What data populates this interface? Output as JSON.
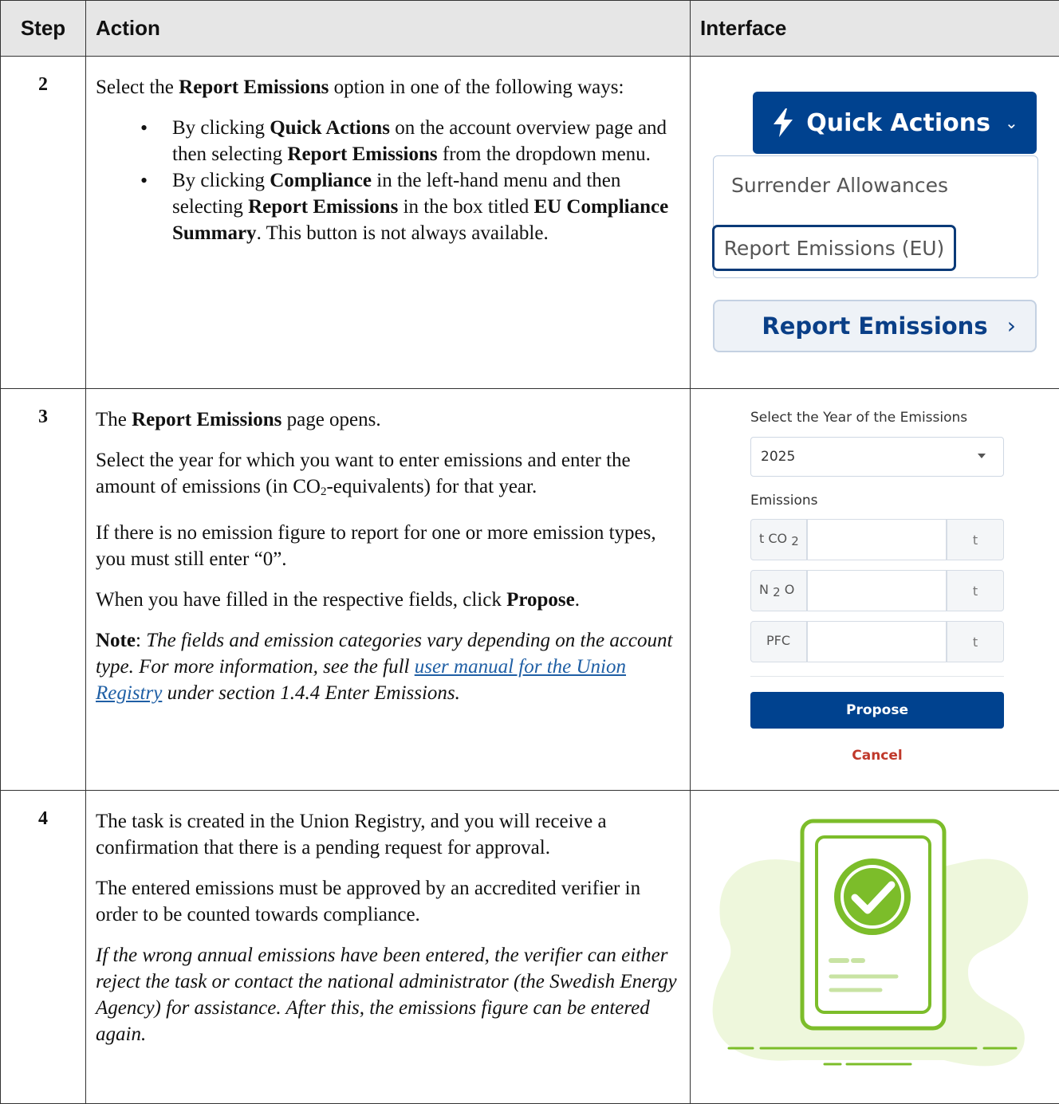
{
  "headers": {
    "step": "Step",
    "action": "Action",
    "interface": "Interface"
  },
  "rows": {
    "r2": {
      "step": "2",
      "p1_pre": "Select the ",
      "p1_bold": "Report Emissions",
      "p1_post": " option in one of the following ways:",
      "b1_t1": "By clicking ",
      "b1_b1": "Quick Actions",
      "b1_t2": " on the account overview page and then selecting ",
      "b1_b2": "Report Emissions",
      "b1_t3": " from the dropdown menu.",
      "b2_t1": "By clicking ",
      "b2_b1": "Compliance",
      "b2_t2": " in the left-hand menu and then selecting ",
      "b2_b2": "Report Emissions",
      "b2_t3": " in the box titled ",
      "b2_b3": "EU Compliance Summary",
      "b2_t4": ". This button is not always available.",
      "ui": {
        "quick_actions": "Quick Actions",
        "chevron": "⌄",
        "menu_item1": "Surrender Allowances",
        "menu_item2": "Report Emissions (EU)",
        "report_btn": "Report Emissions",
        "report_arrow": "›"
      }
    },
    "r3": {
      "step": "3",
      "p1_pre": "The ",
      "p1_bold": "Report Emissions",
      "p1_post": " page opens.",
      "p2_a": "Select the year for which you want to enter emissions and enter the amount of emissions (in CO",
      "p2_sub": "2",
      "p2_b": "-equivalents) for that year.",
      "p3": "If there is no emission figure to report for one or more emission types, you must still enter “0”.",
      "p4_pre": "When you have filled in the respective fields, click ",
      "p4_bold": "Propose",
      "p4_post": ".",
      "note_label": "Note",
      "note_colon": ": ",
      "note_it1": "The fields and emission categories vary depending on the account type. For more information, see the full ",
      "note_link": "user manual for the Union Registry",
      "note_it2": " under section 1.4.4 Enter Emissions.",
      "ui": {
        "year_label": "Select the Year of the Emissions",
        "year_value": "2025",
        "emissions_label": "Emissions",
        "rows": [
          {
            "pre_a": "t CO",
            "pre_sub": "2",
            "pre_b": "",
            "unit": "t"
          },
          {
            "pre_a": "N",
            "pre_sub": "2",
            "pre_b": "O",
            "unit": "t"
          },
          {
            "pre_a": "PFC",
            "pre_sub": "",
            "pre_b": "",
            "unit": "t"
          }
        ],
        "propose": "Propose",
        "cancel": "Cancel"
      }
    },
    "r4": {
      "step": "4",
      "p1": "The task is created in the Union Registry, and you will receive a confirmation that there is a pending request for approval.",
      "p2": "The entered emissions must be approved by an accredited verifier in order to be counted towards compliance.",
      "p3": "If the wrong annual emissions have been entered, the verifier can either reject the task or contact the national administrator (the Swedish Energy Agency) for assistance. After this, the emissions figure can be entered again."
    }
  },
  "colors": {
    "brand_blue": "#00428f",
    "cancel_red": "#c0392b",
    "illus_green": "#7cbd2a",
    "illus_light": "#eef7dc"
  },
  "icons": {
    "quick_actions_icon": "lightning-bolt-icon",
    "illustration_icon": "checkmark-circle-icon"
  }
}
